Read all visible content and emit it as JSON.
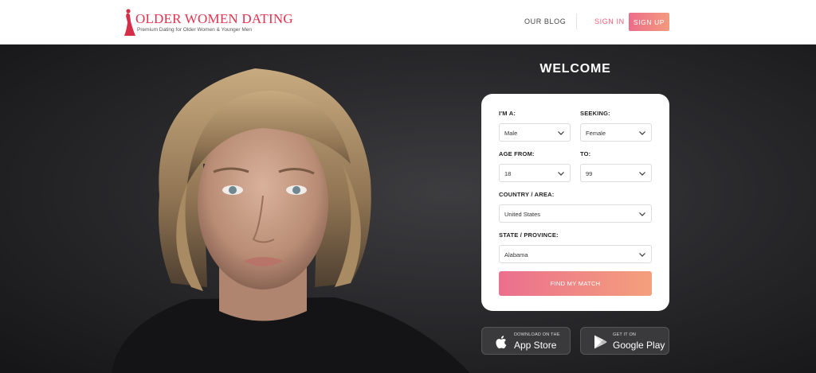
{
  "brand": {
    "title": "OLDER WOMEN DATING",
    "tagline": "Premium Dating for Older Women & Younger Men"
  },
  "nav": {
    "blog": "OUR BLOG",
    "signin": "SIGN IN",
    "signup": "SIGN UP"
  },
  "welcome": "WELCOME",
  "form": {
    "iam": {
      "label": "I'M A:",
      "value": "Male"
    },
    "seeking": {
      "label": "SEEKING:",
      "value": "Female"
    },
    "age_from": {
      "label": "AGE FROM:",
      "value": "18"
    },
    "age_to": {
      "label": "TO:",
      "value": "99"
    },
    "country": {
      "label": "COUNTRY / AREA:",
      "value": "United States"
    },
    "state": {
      "label": "STATE / PROVINCE:",
      "value": "Alabama"
    },
    "submit": "FIND MY MATCH"
  },
  "stores": {
    "apple": {
      "small": "DOWNLOAD ON THE",
      "big": "App Store",
      "icon": "apple-icon"
    },
    "google": {
      "small": "GET IT ON",
      "big": "Google Play",
      "icon": "google-play-icon"
    }
  },
  "colors": {
    "brand": "#e0334e",
    "accent_start": "#eb6f8e",
    "accent_end": "#f4a07c",
    "hero_bg": "#2a2a2d"
  }
}
